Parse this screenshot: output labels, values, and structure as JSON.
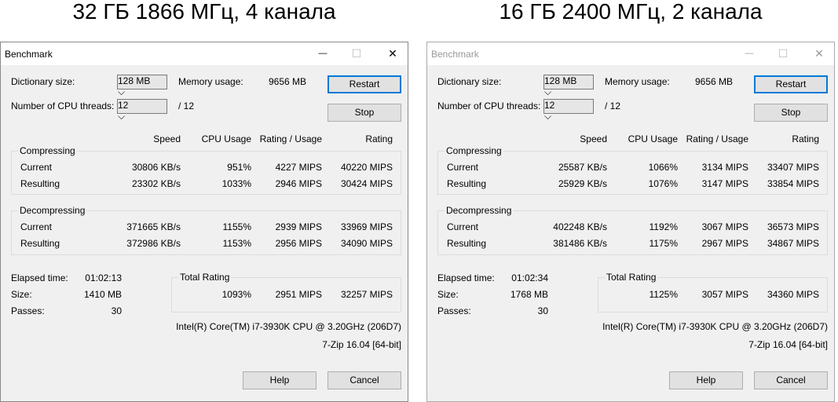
{
  "panels": [
    {
      "caption": "32 ГБ 1866 МГц, 4 канала",
      "title": "Benchmark",
      "active": true,
      "dict_label": "Dictionary size:",
      "dict_value": "128 MB",
      "mem_label": "Memory usage:",
      "mem_value": "9656 MB",
      "threads_label": "Number of CPU threads:",
      "threads_value": "12",
      "threads_max": "/ 12",
      "restart": "Restart",
      "stop": "Stop",
      "headers": {
        "speed": "Speed",
        "cpu": "CPU Usage",
        "rpu": "Rating / Usage",
        "rating": "Rating"
      },
      "compressing": {
        "label": "Compressing",
        "rows": [
          {
            "label": "Current",
            "speed": "30806 KB/s",
            "cpu": "951%",
            "rpu": "4227 MIPS",
            "rating": "40220 MIPS"
          },
          {
            "label": "Resulting",
            "speed": "23302 KB/s",
            "cpu": "1033%",
            "rpu": "2946 MIPS",
            "rating": "30424 MIPS"
          }
        ]
      },
      "decompressing": {
        "label": "Decompressing",
        "rows": [
          {
            "label": "Current",
            "speed": "371665 KB/s",
            "cpu": "1155%",
            "rpu": "2939 MIPS",
            "rating": "33969 MIPS"
          },
          {
            "label": "Resulting",
            "speed": "372986 KB/s",
            "cpu": "1153%",
            "rpu": "2956 MIPS",
            "rating": "34090 MIPS"
          }
        ]
      },
      "elapsed_label": "Elapsed time:",
      "elapsed": "01:02:13",
      "size_label": "Size:",
      "size": "1410 MB",
      "passes_label": "Passes:",
      "passes": "30",
      "total": {
        "label": "Total Rating",
        "cpu": "1093%",
        "rpu": "2951 MIPS",
        "rating": "32257 MIPS"
      },
      "cpu_info": "Intel(R) Core(TM) i7-3930K CPU @ 3.20GHz (206D7)",
      "version": "7-Zip 16.04 [64-bit]",
      "help": "Help",
      "cancel": "Cancel"
    },
    {
      "caption": "16 ГБ 2400 МГц, 2 канала",
      "title": "Benchmark",
      "active": false,
      "dict_label": "Dictionary size:",
      "dict_value": "128 MB",
      "mem_label": "Memory usage:",
      "mem_value": "9656 MB",
      "threads_label": "Number of CPU threads:",
      "threads_value": "12",
      "threads_max": "/ 12",
      "restart": "Restart",
      "stop": "Stop",
      "headers": {
        "speed": "Speed",
        "cpu": "CPU Usage",
        "rpu": "Rating / Usage",
        "rating": "Rating"
      },
      "compressing": {
        "label": "Compressing",
        "rows": [
          {
            "label": "Current",
            "speed": "25587 KB/s",
            "cpu": "1066%",
            "rpu": "3134 MIPS",
            "rating": "33407 MIPS"
          },
          {
            "label": "Resulting",
            "speed": "25929 KB/s",
            "cpu": "1076%",
            "rpu": "3147 MIPS",
            "rating": "33854 MIPS"
          }
        ]
      },
      "decompressing": {
        "label": "Decompressing",
        "rows": [
          {
            "label": "Current",
            "speed": "402248 KB/s",
            "cpu": "1192%",
            "rpu": "3067 MIPS",
            "rating": "36573 MIPS"
          },
          {
            "label": "Resulting",
            "speed": "381486 KB/s",
            "cpu": "1175%",
            "rpu": "2967 MIPS",
            "rating": "34867 MIPS"
          }
        ]
      },
      "elapsed_label": "Elapsed time:",
      "elapsed": "01:02:34",
      "size_label": "Size:",
      "size": "1768 MB",
      "passes_label": "Passes:",
      "passes": "30",
      "total": {
        "label": "Total Rating",
        "cpu": "1125%",
        "rpu": "3057 MIPS",
        "rating": "34360 MIPS"
      },
      "cpu_info": "Intel(R) Core(TM) i7-3930K CPU @ 3.20GHz (206D7)",
      "version": "7-Zip 16.04 [64-bit]",
      "help": "Help",
      "cancel": "Cancel"
    }
  ],
  "icons": {
    "minimize": "—",
    "maximize": "☐",
    "close": "✕",
    "dropdown": "⌵"
  }
}
